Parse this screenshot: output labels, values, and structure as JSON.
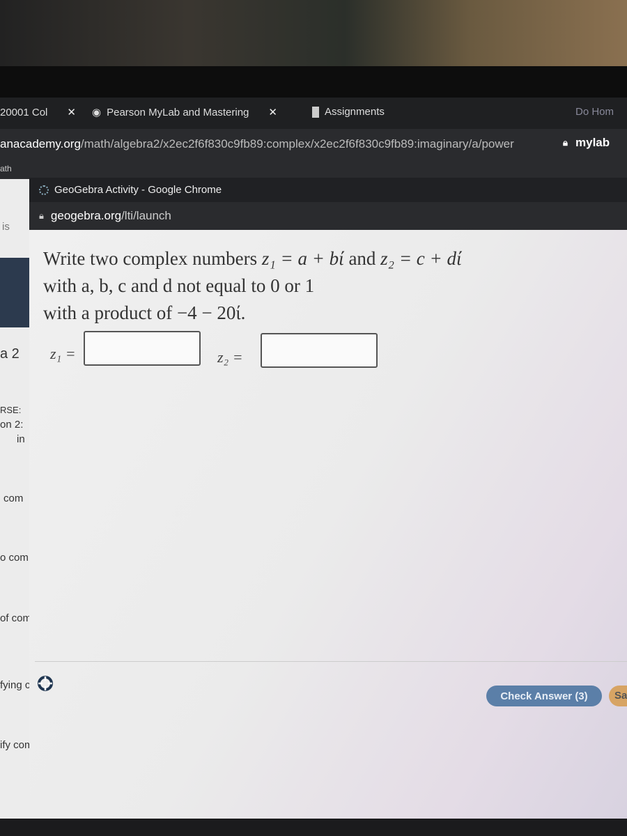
{
  "browser": {
    "tabs": [
      {
        "label": "20001 Col"
      },
      {
        "label": "Pearson MyLab and Mastering"
      },
      {
        "label": "Assignments"
      },
      {
        "label": "Do Hom"
      }
    ],
    "url_domain": "anacademy.org",
    "url_path": "/math/algebra2/x2ec2f6f830c9fb89:complex/x2ec2f6f830c9fb89:imaginary/a/power",
    "side_url": "mylab",
    "bookmark_partial": "ath"
  },
  "background_page": {
    "fragments": [
      "is",
      "a 2",
      "RSE:",
      "on 2:",
      "in",
      "com",
      "o com",
      "of com",
      "fying c",
      "ify com"
    ]
  },
  "popup": {
    "title": "GeoGebra Activity - Google Chrome",
    "url_domain": "geogebra.org",
    "url_path": "/lti/launch"
  },
  "activity": {
    "line1_a": "Write two complex numbers ",
    "z1": "z₁ = a + bί",
    "line1_and": " and ",
    "z2": "z₂ = c + dί",
    "line2": "with a, b, c and d not equal to 0 or 1",
    "line3": "with a product of −4 − 20ί.",
    "z1_label": "z₁ =",
    "z2_label": "z₂ =",
    "z1_value": "",
    "z2_value": ""
  },
  "buttons": {
    "check_answer": "Check Answer (3)",
    "save": "Sa"
  },
  "colors": {
    "check_answer": "#5b7fa8",
    "save": "#d7a464"
  },
  "icons": {
    "help": "lifebuoy-icon",
    "lock": "lock-icon"
  }
}
